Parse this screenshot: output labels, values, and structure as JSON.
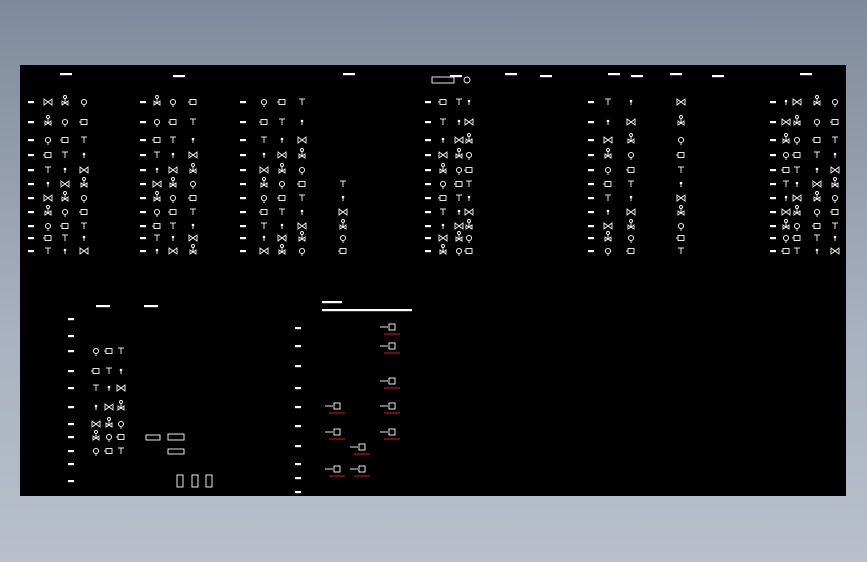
{
  "viewport": {
    "background": "#a0aab8",
    "sheet_background": "#000000",
    "line_color": "#ffffff",
    "marker_color": "#e01818"
  },
  "sheet": {
    "name": "cad-symbol-legend-sheet"
  },
  "top_headers": [
    "",
    "",
    "",
    "",
    "",
    "",
    "",
    ""
  ],
  "groups": [
    {
      "name": "group-1",
      "rows": 11,
      "cols": 3,
      "icon": "valve-symbol-icon"
    },
    {
      "name": "group-2",
      "rows": 11,
      "cols": 3,
      "icon": "valve-symbol-icon"
    },
    {
      "name": "group-3",
      "rows": 11,
      "cols": 4,
      "icon": "fitting-symbol-icon"
    },
    {
      "name": "group-4",
      "rows": 11,
      "cols": 3,
      "icon": "equipment-symbol-icon"
    },
    {
      "name": "group-5",
      "rows": 11,
      "cols": 3,
      "icon": "instrument-symbol-icon"
    },
    {
      "name": "group-6",
      "rows": 11,
      "cols": 4,
      "icon": "pump-symbol-icon"
    }
  ],
  "lower_sections": [
    {
      "name": "lower-left-table",
      "icon": "valve-symbol-icon"
    },
    {
      "name": "lower-middle-table",
      "icon": "instrument-symbol-icon"
    }
  ]
}
